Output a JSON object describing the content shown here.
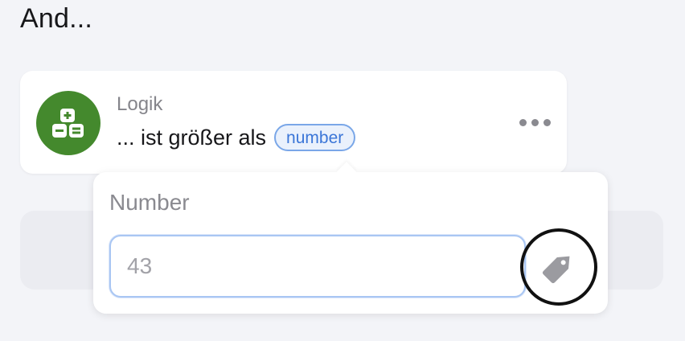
{
  "section": {
    "title": "And..."
  },
  "condition_card": {
    "category": "Logik",
    "text": "... ist größer als",
    "param_chip": "number",
    "avatar_color": "#44892d",
    "avatar_icon": "calculator-icon",
    "more_icon": "more-horizontal-icon"
  },
  "popover": {
    "field_label": "Number",
    "input_value": "",
    "input_placeholder": "43",
    "tag_icon": "tag-icon"
  }
}
